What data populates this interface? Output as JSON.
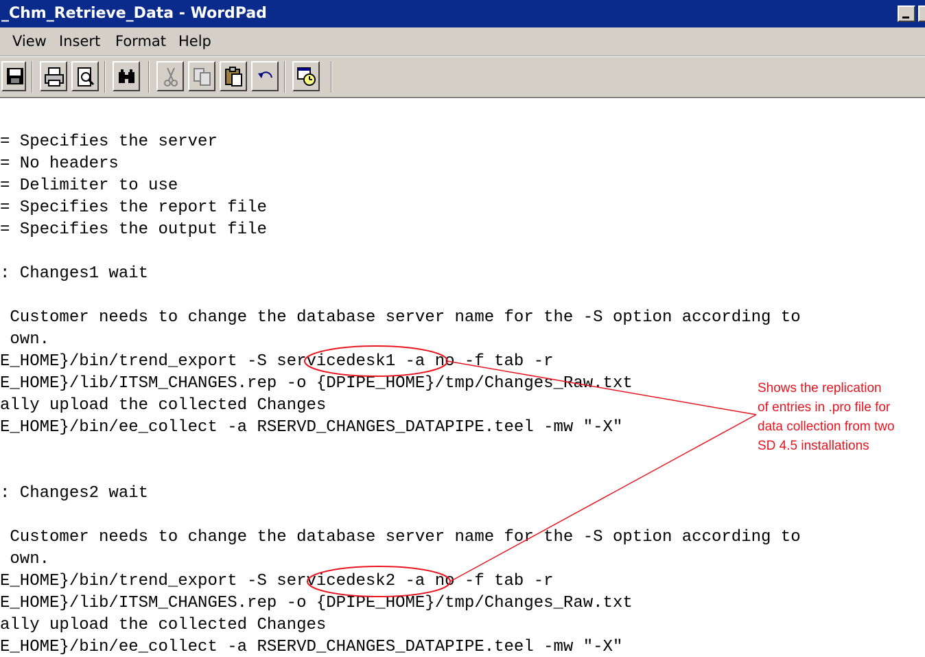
{
  "window": {
    "title": "_Chm_Retrieve_Data - WordPad"
  },
  "menu": {
    "items": [
      "View",
      "Insert",
      "Format",
      "Help"
    ]
  },
  "toolbar": {
    "buttons": [
      "save-icon",
      "print-icon",
      "print-preview-icon",
      "find-icon",
      "cut-icon",
      "copy-icon",
      "paste-icon",
      "undo-icon",
      "insert-datetime-icon"
    ]
  },
  "document": {
    "lines": [
      "= Specifies the server",
      "= No headers",
      "= Delimiter to use",
      "= Specifies the report file",
      "= Specifies the output file",
      ": Changes1 wait",
      " Customer needs to change the database server name for the -S option according to",
      " own.",
      "E_HOME}/bin/trend_export -S servicedesk1 -a no -f tab -r",
      "E_HOME}/lib/ITSM_CHANGES.rep -o {DPIPE_HOME}/tmp/Changes_Raw.txt",
      "ally upload the collected Changes",
      "E_HOME}/bin/ee_collect -a RSERVD_CHANGES_DATAPIPE.teel -mw \"-X\"",
      ": Changes2 wait",
      " Customer needs to change the database server name for the -S option according to",
      " own.",
      "E_HOME}/bin/trend_export -S servicedesk2 -a no -f tab -r",
      "E_HOME}/lib/ITSM_CHANGES.rep -o {DPIPE_HOME}/tmp/Changes_Raw.txt",
      "ally upload the collected Changes",
      "E_HOME}/bin/ee_collect -a RSERVD_CHANGES_DATAPIPE.teel -mw \"-X\""
    ]
  },
  "annotation": {
    "lines": [
      "Shows the replication",
      "of entries in .pro file for",
      "data collection from two",
      "SD 4.5 installations"
    ],
    "color": "#e8141e"
  }
}
